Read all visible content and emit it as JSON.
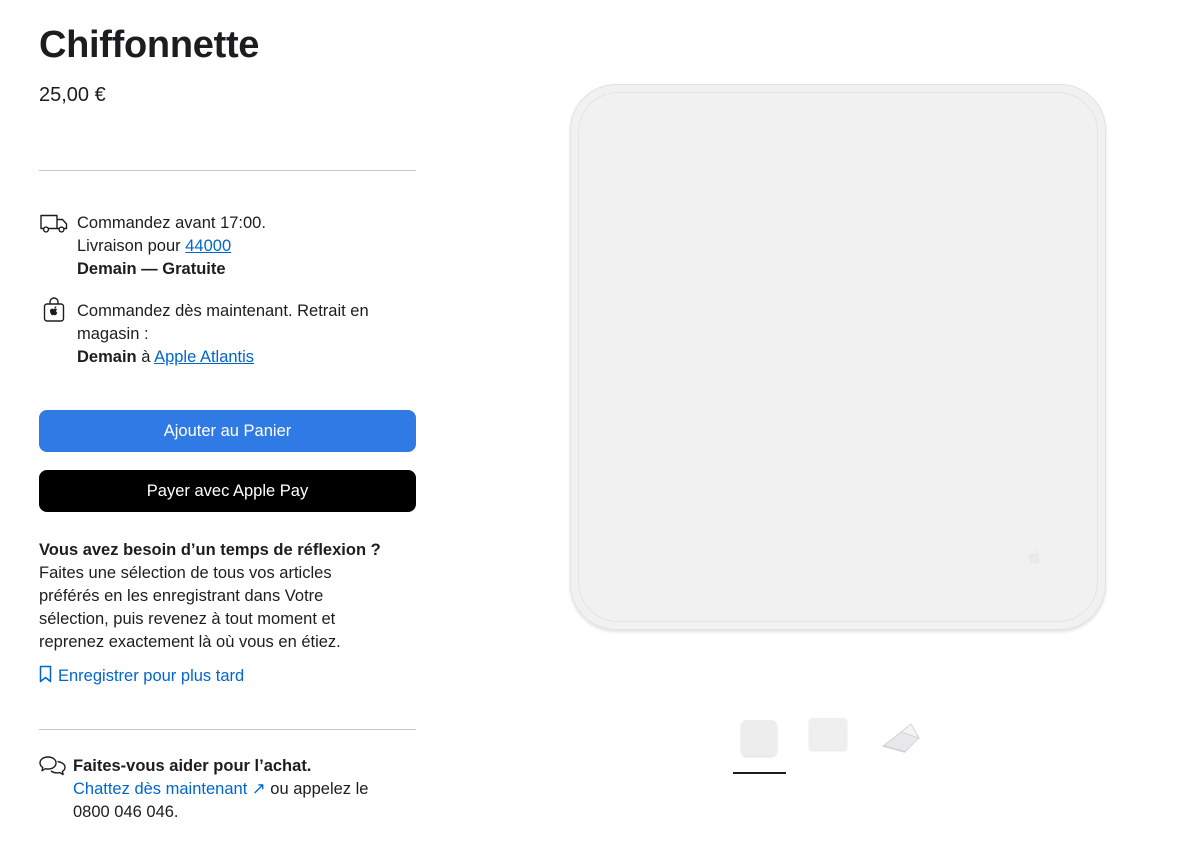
{
  "product": {
    "title": "Chiffonnette",
    "price": "25,00 €"
  },
  "delivery": {
    "icon": "truck-icon",
    "line1": "Commandez avant 17:00.",
    "line2_prefix": "Livraison pour",
    "postcode": "44000",
    "when": "Demain — Gratuite"
  },
  "pickup": {
    "icon": "shopping-bag-icon",
    "line1": "Commandez dès maintenant. Retrait en magasin :",
    "when": "Demain",
    "connector": "à",
    "store": "Apple Atlantis"
  },
  "buttons": {
    "add_to_cart": "Ajouter au Panier",
    "apple_pay": "Payer avec Apple Pay"
  },
  "think": {
    "heading": "Vous avez besoin d’un temps de réflexion ?",
    "body": "Faites une sélection de tous vos articles préférés en les enregistrant dans Votre sélection, puis revenez à tout moment et reprenez exactement là où vous en étiez.",
    "save_label": "Enregistrer pour plus tard",
    "save_icon": "bookmark-icon"
  },
  "help": {
    "icon": "chat-bubbles-icon",
    "heading": "Faites-vous aider pour l’achat.",
    "chat_label": "Chattez dès maintenant",
    "chat_arrow": "↗",
    "suffix": "ou appelez le",
    "phone": "0800 046 046."
  },
  "gallery": {
    "selected_index": 0,
    "thumbnail_count": 3
  },
  "colors": {
    "accent": "#2f7ae5",
    "link": "#0066cc",
    "pay_button": "#000000"
  }
}
